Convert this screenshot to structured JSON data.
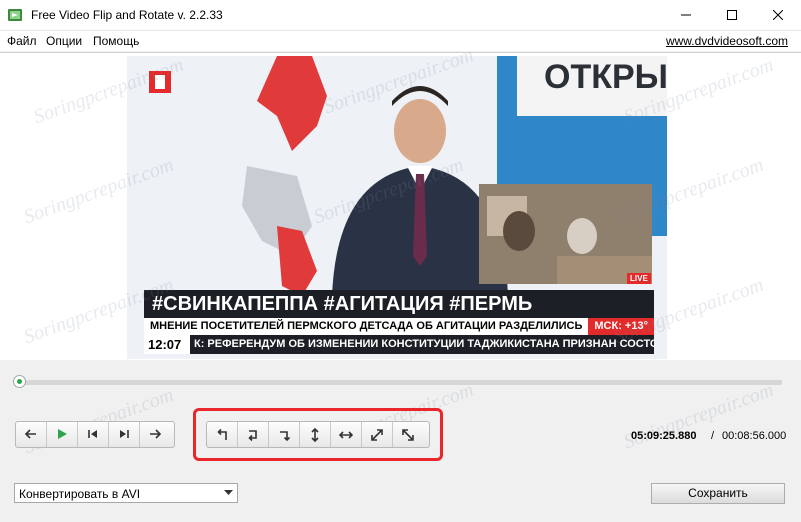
{
  "window": {
    "title": "Free Video Flip and Rotate v. 2.2.33"
  },
  "menu": {
    "items": [
      "Файл",
      "Опции",
      "Помощь"
    ],
    "site": "www.dvdvideosoft.com"
  },
  "video": {
    "logo_text": "ОТКРЫ",
    "headline": "#СВИНКАПЕППА #АГИТАЦИЯ #ПЕРМЬ",
    "subline": "МНЕНИЕ ПОСЕТИТЕЛЕЙ ПЕРМСКОГО ДЕТСАДА ОБ АГИТАЦИИ РАЗДЕЛИЛИСЬ",
    "msk": "МСК: +13°",
    "clock": "12:07",
    "ticker": "К: РЕФЕРЕНДУМ ОБ ИЗМЕНЕНИИ КОНСТИТУЦИИ ТАДЖИКИСТАНА ПРИЗНАН СОСТОЯВШ",
    "live": "LIVE"
  },
  "seek": {
    "progress": 0.0
  },
  "time": {
    "current": "05:09:25.880",
    "separator": "/",
    "total": "00:08:56.000"
  },
  "convert": {
    "selected": "Конвертировать в AVI"
  },
  "actions": {
    "save": "Сохранить"
  },
  "watermark": "Soringpcrepair.com",
  "colors": {
    "highlight": "#e8262b",
    "play": "#2ea44f",
    "ticker_red": "#e32b2b"
  }
}
